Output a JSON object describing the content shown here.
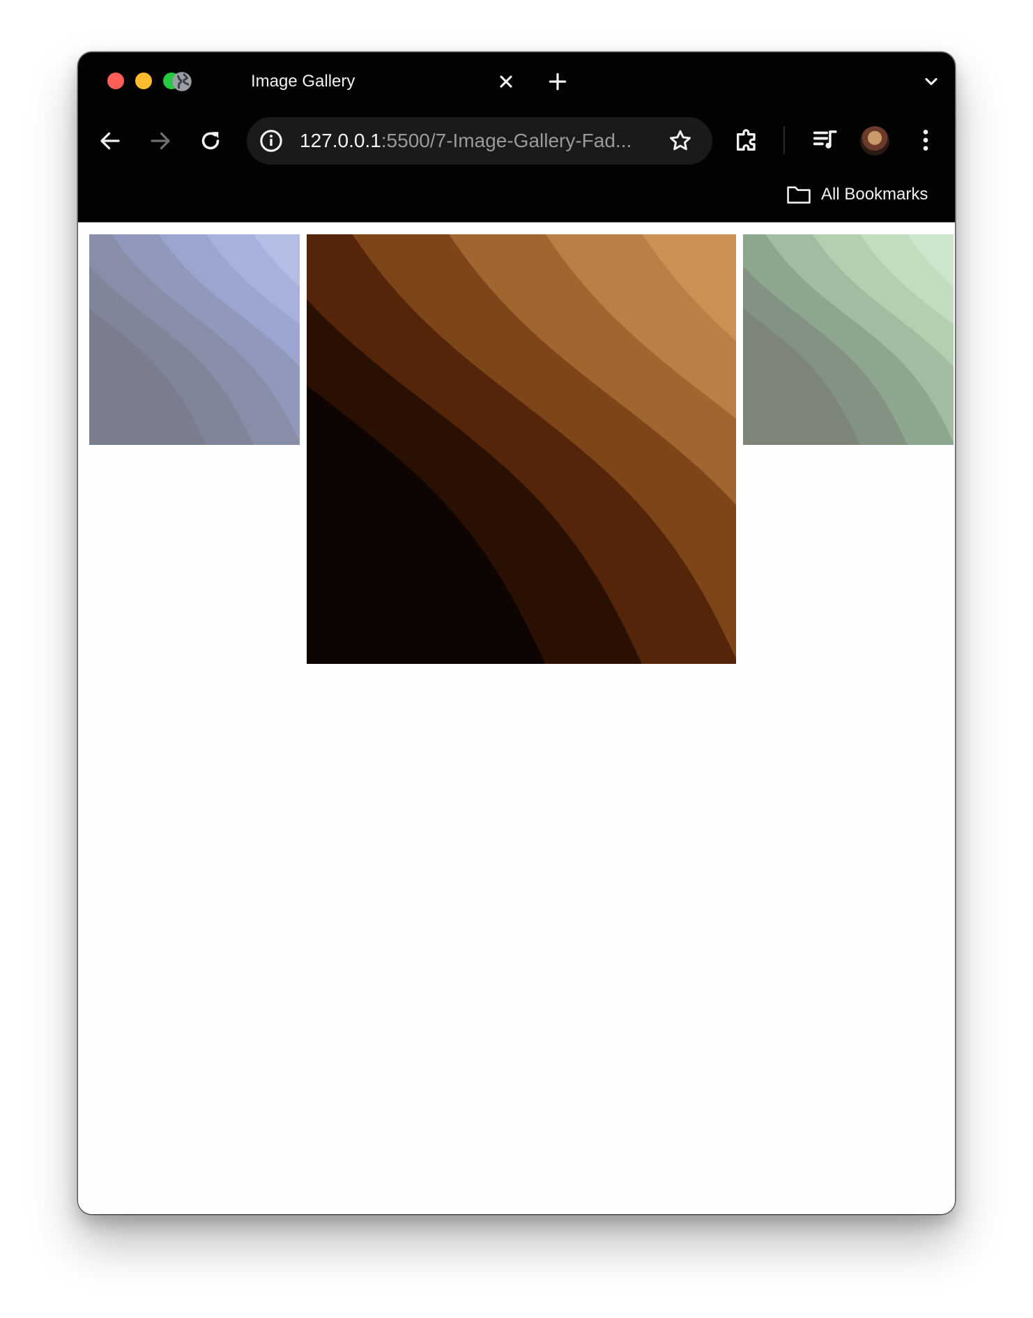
{
  "tab": {
    "title": "Image Gallery",
    "icon": "globe-icon"
  },
  "address_bar": {
    "url_host": "127.0.0.1",
    "url_path": ":5500/7-Image-Gallery-Fad..."
  },
  "bookmarks_bar": {
    "label": "All Bookmarks",
    "icon": "folder-icon"
  },
  "colors": {
    "traffic_red": "#fe5f57",
    "traffic_yellow": "#febc2e",
    "traffic_green": "#28c840",
    "chrome_background": "#020202",
    "omnibox_background": "#1a1a1a"
  },
  "gallery": {
    "images": [
      {
        "name": "blue-waves",
        "palette": [
          "#7a7d8e",
          "#808599",
          "#888ea8",
          "#9098bb",
          "#9ba5cf",
          "#a7b1dc",
          "#b3bde6",
          "#bcc6ec"
        ]
      },
      {
        "name": "brown-waves",
        "palette": [
          "#0e0402",
          "#2a1003",
          "#55250a",
          "#7e4519",
          "#a1662f",
          "#b97f44",
          "#c99153",
          "#d29f5d"
        ]
      },
      {
        "name": "green-waves",
        "palette": [
          "#7d8478",
          "#829383",
          "#8fa68e",
          "#a3bca1",
          "#b3cfb0",
          "#c3dcc0",
          "#cde5ca",
          "#d4eace"
        ]
      }
    ]
  }
}
